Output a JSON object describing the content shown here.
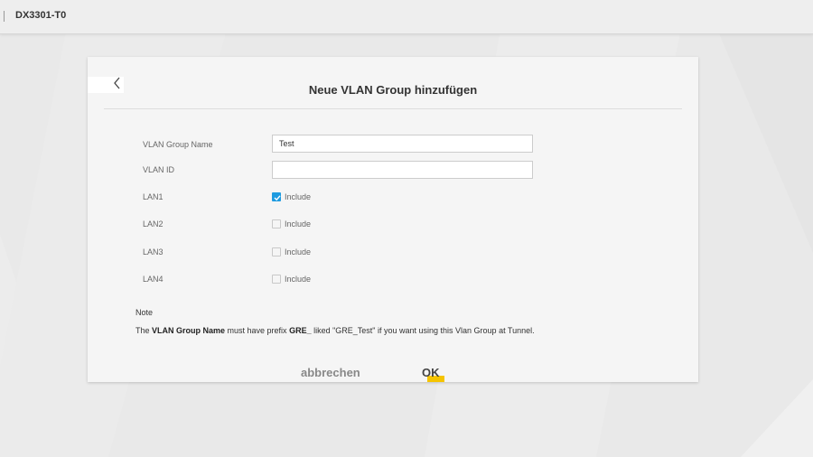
{
  "header": {
    "device_name": "DX3301-T0"
  },
  "dialog": {
    "title": "Neue VLAN Group hinzufügen",
    "fields": {
      "group_name_label": "VLAN Group Name",
      "group_name_value": "Test",
      "vlan_id_label": "VLAN ID",
      "vlan_id_value": ""
    },
    "ports": [
      {
        "label": "LAN1",
        "option": "Include",
        "checked": true
      },
      {
        "label": "LAN2",
        "option": "Include",
        "checked": false
      },
      {
        "label": "LAN3",
        "option": "Include",
        "checked": false
      },
      {
        "label": "LAN4",
        "option": "Include",
        "checked": false
      }
    ],
    "note": {
      "title": "Note",
      "text_1": "The ",
      "bold_1": "VLAN Group Name",
      "text_2": " must have prefix ",
      "bold_2": "GRE_",
      "text_3": " liked \"GRE_Test\" if you want using this Vlan Group at Tunnel."
    },
    "buttons": {
      "cancel": "abbrechen",
      "ok": "OK"
    }
  },
  "colors": {
    "checkbox_checked": "#1e9be0",
    "ok_accent": "#f5c400"
  },
  "icons": {
    "back": "chevron-left-icon",
    "check": "checkmark-icon"
  }
}
